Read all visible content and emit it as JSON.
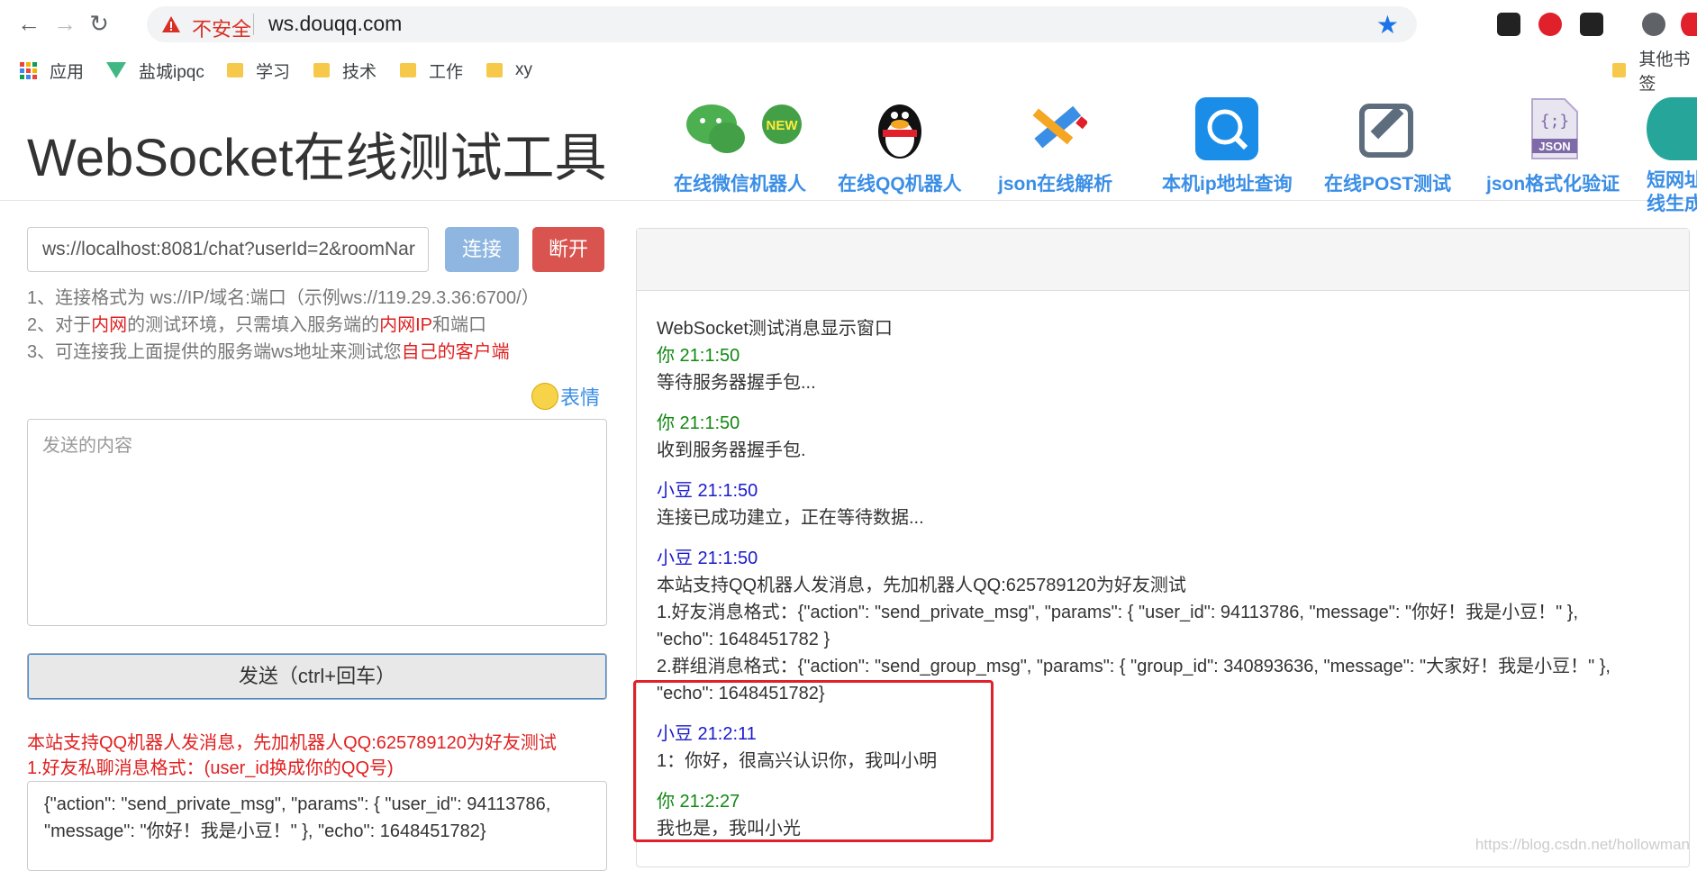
{
  "browser": {
    "insecure_label": "不安全",
    "url": "ws.douqq.com",
    "bookmarks": [
      "应用",
      "盐城ipqc",
      "学习",
      "技术",
      "工作",
      "xy"
    ],
    "other_bookmarks": "其他书签"
  },
  "header": {
    "title": "WebSocket在线测试工具",
    "tools": [
      "在线微信机器人",
      "在线QQ机器人",
      "json在线解析",
      "本机ip地址查询",
      "在线POST测试",
      "json格式化验证",
      "短网址在",
      "线生成"
    ],
    "wechat_new_badge": "NEW",
    "json_badge": "JSON"
  },
  "left": {
    "ws_url": "ws://localhost:8081/chat?userId=2&roomNar",
    "connect_label": "连接",
    "disconnect_label": "断开",
    "help1": "1、连接格式为 ws://IP/域名:端口（示例ws://119.29.3.36:6700/）",
    "help2_a": "2、对于",
    "help2_b": "内网",
    "help2_c": "的测试环境，只需填入服务端的",
    "help2_d": "内网IP",
    "help2_e": "和端口",
    "help3_a": "3、可连接我上面提供的服务端ws地址来测试您",
    "help3_b": "自己的客户端",
    "emoji_label": "表情",
    "send_placeholder": "发送的内容",
    "send_button": "发送（ctrl+回车）",
    "note1": "本站支持QQ机器人发消息，先加机器人QQ:625789120为好友测试",
    "note2": "1.好友私聊消息格式：(user_id换成你的QQ号)",
    "json_line1": "{\"action\": \"send_private_msg\", \"params\": { \"user_id\": 94113786,",
    "json_line2": "\"message\": \"你好！我是小豆！\" }, \"echo\": 1648451782}"
  },
  "messages": {
    "window_title": "WebSocket测试消息显示窗口",
    "items": [
      {
        "sender": "你 21:1:50",
        "lines": [
          "等待服务器握手包..."
        ]
      },
      {
        "sender": "你 21:1:50",
        "lines": [
          "收到服务器握手包."
        ]
      },
      {
        "sender": "小豆 21:1:50",
        "lines": [
          "连接已成功建立，正在等待数据..."
        ]
      },
      {
        "sender": "小豆 21:1:50",
        "lines": [
          "本站支持QQ机器人发消息，先加机器人QQ:625789120为好友测试",
          "1.好友消息格式：{\"action\": \"send_private_msg\", \"params\": { \"user_id\": 94113786, \"message\": \"你好！我是小豆！\" },",
          "\"echo\": 1648451782 }",
          "2.群组消息格式：{\"action\": \"send_group_msg\", \"params\": { \"group_id\": 340893636, \"message\": \"大家好！我是小豆！\" },",
          "\"echo\": 1648451782}"
        ]
      },
      {
        "sender": "小豆 21:2:11",
        "lines": [
          "1：你好，很高兴认识你，我叫小明"
        ]
      },
      {
        "sender": "你 21:2:27",
        "lines": [
          "我也是，我叫小光"
        ]
      }
    ]
  },
  "watermark": "https://blog.csdn.net/hollowman",
  "colors": {
    "accent_blue": "#3a8ee6",
    "connect": "#8fb6e0",
    "disconnect": "#d9534f",
    "you_sender": "#118811",
    "bean_sender": "#1a1acc",
    "highlight_box": "#e0202a"
  }
}
